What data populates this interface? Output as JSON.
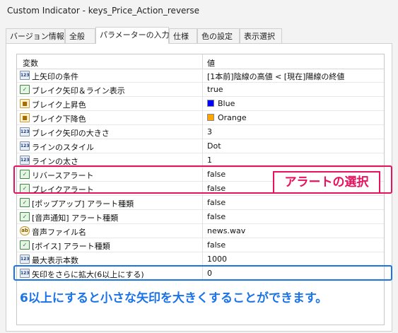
{
  "window": {
    "title": "Custom Indicator - keys_Price_Action_reverse"
  },
  "tabs": [
    {
      "label": "バージョン情報"
    },
    {
      "label": "全般"
    },
    {
      "label": "パラメーターの入力"
    },
    {
      "label": "仕様"
    },
    {
      "label": "色の設定"
    },
    {
      "label": "表示選択"
    }
  ],
  "grid": {
    "headers": {
      "variable": "変数",
      "value": "値"
    },
    "rows": [
      {
        "icon": "123-int-icon",
        "name": "上矢印の条件",
        "value": "[1本前]陰線の高値 < [現在]陽線の終値"
      },
      {
        "icon": "bool-toggle-icon",
        "name": "ブレイク矢印＆ライン表示",
        "value": "true"
      },
      {
        "icon": "color-palette-icon",
        "name": "ブレイク上昇色",
        "value": "Blue",
        "swatch": "#0000ff"
      },
      {
        "icon": "color-palette-icon",
        "name": "ブレイク下降色",
        "value": "Orange",
        "swatch": "#ffa500"
      },
      {
        "icon": "123-int-icon",
        "name": "ブレイク矢印の大きさ",
        "value": "3"
      },
      {
        "icon": "123-int-icon",
        "name": "ラインのスタイル",
        "value": "Dot"
      },
      {
        "icon": "123-int-icon",
        "name": "ラインの太さ",
        "value": "1"
      },
      {
        "icon": "bool-toggle-icon",
        "name": "リバースアラート",
        "value": "false"
      },
      {
        "icon": "bool-toggle-icon",
        "name": "ブレイクアラート",
        "value": "false"
      },
      {
        "icon": "bool-toggle-icon",
        "name": "[ポップアップ] アラート種類",
        "value": "false"
      },
      {
        "icon": "bool-toggle-icon",
        "name": "[音声通知] アラート種類",
        "value": "false"
      },
      {
        "icon": "ab-string-icon",
        "name": "音声ファイル名",
        "value": "news.wav"
      },
      {
        "icon": "bool-toggle-icon",
        "name": "[ボイス] アラート種類",
        "value": "false"
      },
      {
        "icon": "123-int-icon",
        "name": "最大表示本数",
        "value": "1000"
      },
      {
        "icon": "123-int-icon",
        "name": "矢印をさらに拡大(6以上にする)",
        "value": "0"
      }
    ]
  },
  "annotations": {
    "alert_select_label": "アラートの選択",
    "enlarge_caption": "6以上にすると小さな矢印を大きくすることができます。"
  },
  "colors": {
    "highlight_red": "#e8115d",
    "highlight_blue": "#1a73e8"
  }
}
